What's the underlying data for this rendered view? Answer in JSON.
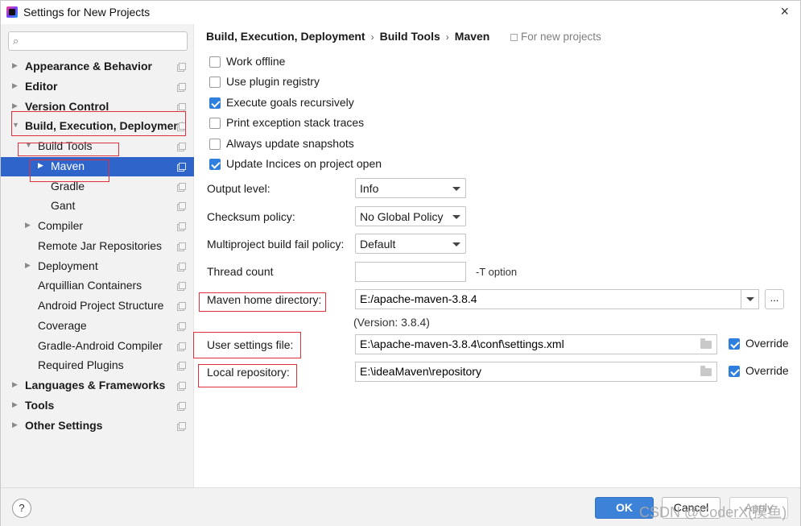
{
  "window": {
    "title": "Settings for New Projects",
    "close_glyph": "×"
  },
  "search": {
    "placeholder": "",
    "value": "",
    "icon": "search-icon"
  },
  "tree": [
    {
      "label": "Appearance & Behavior",
      "bold": true,
      "arrow": "▶"
    },
    {
      "label": "Editor",
      "bold": true,
      "arrow": "▶"
    },
    {
      "label": "Version Control",
      "bold": true,
      "arrow": "▶"
    },
    {
      "label": "Build, Execution, Deployment",
      "bold": true,
      "arrow": "▼"
    },
    {
      "label": "Build Tools",
      "bold": false,
      "arrow": "▼"
    },
    {
      "label": "Maven",
      "bold": false,
      "arrow": "▶",
      "selected": true
    },
    {
      "label": "Gradle",
      "bold": false,
      "arrow": ""
    },
    {
      "label": "Gant",
      "bold": false,
      "arrow": ""
    },
    {
      "label": "Compiler",
      "bold": false,
      "arrow": "▶"
    },
    {
      "label": "Remote Jar Repositories",
      "bold": false,
      "arrow": ""
    },
    {
      "label": "Deployment",
      "bold": false,
      "arrow": "▶"
    },
    {
      "label": "Arquillian Containers",
      "bold": false,
      "arrow": ""
    },
    {
      "label": "Android Project Structure",
      "bold": false,
      "arrow": ""
    },
    {
      "label": "Coverage",
      "bold": false,
      "arrow": ""
    },
    {
      "label": "Gradle-Android Compiler",
      "bold": false,
      "arrow": ""
    },
    {
      "label": "Required Plugins",
      "bold": false,
      "arrow": ""
    },
    {
      "label": "Languages & Frameworks",
      "bold": true,
      "arrow": "▶"
    },
    {
      "label": "Tools",
      "bold": true,
      "arrow": "▶"
    },
    {
      "label": "Other Settings",
      "bold": true,
      "arrow": "▶"
    }
  ],
  "breadcrumb": {
    "items": [
      "Build, Execution, Deployment",
      "Build Tools",
      "Maven"
    ],
    "separator": "›",
    "note": "For new projects"
  },
  "checkboxes": [
    {
      "label": "Work offline",
      "checked": false
    },
    {
      "label": "Use plugin registry",
      "checked": false
    },
    {
      "label": "Execute goals recursively",
      "checked": true
    },
    {
      "label": "Print exception stack traces",
      "checked": false
    },
    {
      "label": "Always update snapshots",
      "checked": false
    },
    {
      "label": "Update Incices on project open",
      "checked": true
    }
  ],
  "form": {
    "output_level": {
      "label": "Output level:",
      "value": "Info"
    },
    "checksum_policy": {
      "label": "Checksum policy:",
      "value": "No Global Policy"
    },
    "multiproject_policy": {
      "label": "Multiproject build fail policy:",
      "value": "Default"
    },
    "thread_count": {
      "label": "Thread count",
      "value": "",
      "hint": "-T option"
    },
    "maven_home": {
      "label": "Maven home directory:",
      "value": "E:/apache-maven-3.8.4",
      "version": "(Version: 3.8.4)",
      "browse_label": "..."
    },
    "user_settings": {
      "label": "User settings file:",
      "value": "E:\\apache-maven-3.8.4\\conf\\settings.xml",
      "override_label": "Override",
      "override_checked": true
    },
    "local_repo": {
      "label": "Local repository:",
      "value": "E:\\ideaMaven\\repository",
      "override_label": "Override",
      "override_checked": true
    }
  },
  "footer": {
    "help": "?",
    "ok": "OK",
    "cancel": "Cancel",
    "apply": "Apply",
    "watermark": "CSDN @CoderX(摸鱼)"
  },
  "colors": {
    "selection": "#2f65ca",
    "ok_button": "#3c82d8",
    "checkbox": "#2f7fdf",
    "annotation": "#e0303a"
  }
}
